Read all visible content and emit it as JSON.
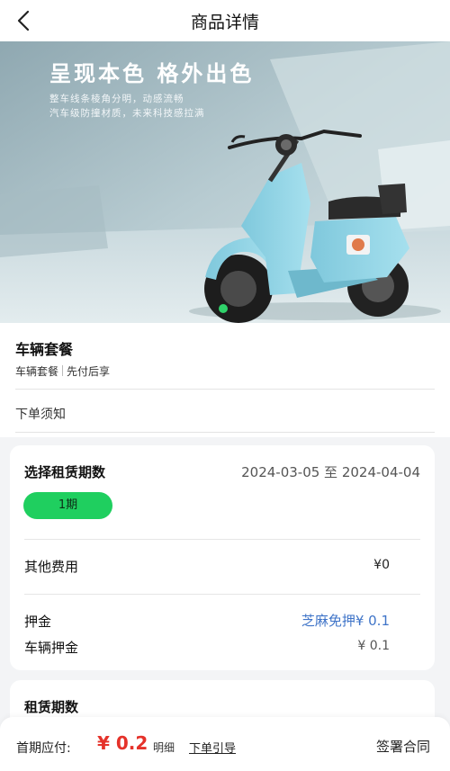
{
  "header": {
    "title": "商品详情",
    "back_icon": "chevron-left-icon"
  },
  "hero": {
    "title": "呈现本色 格外出色",
    "subtitle_line1": "整车线条棱角分明，动感流畅",
    "subtitle_line2": "汽车级防撞材质，未来科技感拉满",
    "scooter_color": "#8fd3e6"
  },
  "package": {
    "title": "车辆套餐",
    "tags": [
      "车辆套餐",
      "先付后享"
    ],
    "notice_label": "下单须知"
  },
  "rental": {
    "period_label": "选择租赁期数",
    "date_range": "2024-03-05 至 2024-04-04",
    "selected_period": "1期",
    "other_fees_label": "其他费用",
    "other_fees_value": "¥0",
    "deposit_label": "押金",
    "deposit_value": "芝麻免押¥ 0.1",
    "vehicle_deposit_label": "车辆押金",
    "vehicle_deposit_value": "¥ 0.1"
  },
  "rental_periods": {
    "label": "租赁期数"
  },
  "footer": {
    "first_payment_label": "首期应付:",
    "first_payment_value": "¥ 0.2",
    "detail_label": "明细",
    "order_guide_label": "下单引导",
    "sign_contract_label": "签署合同"
  },
  "colors": {
    "accent_green": "#1fcf5f",
    "price_red": "#e5322a",
    "link_blue": "#3f74c8"
  }
}
